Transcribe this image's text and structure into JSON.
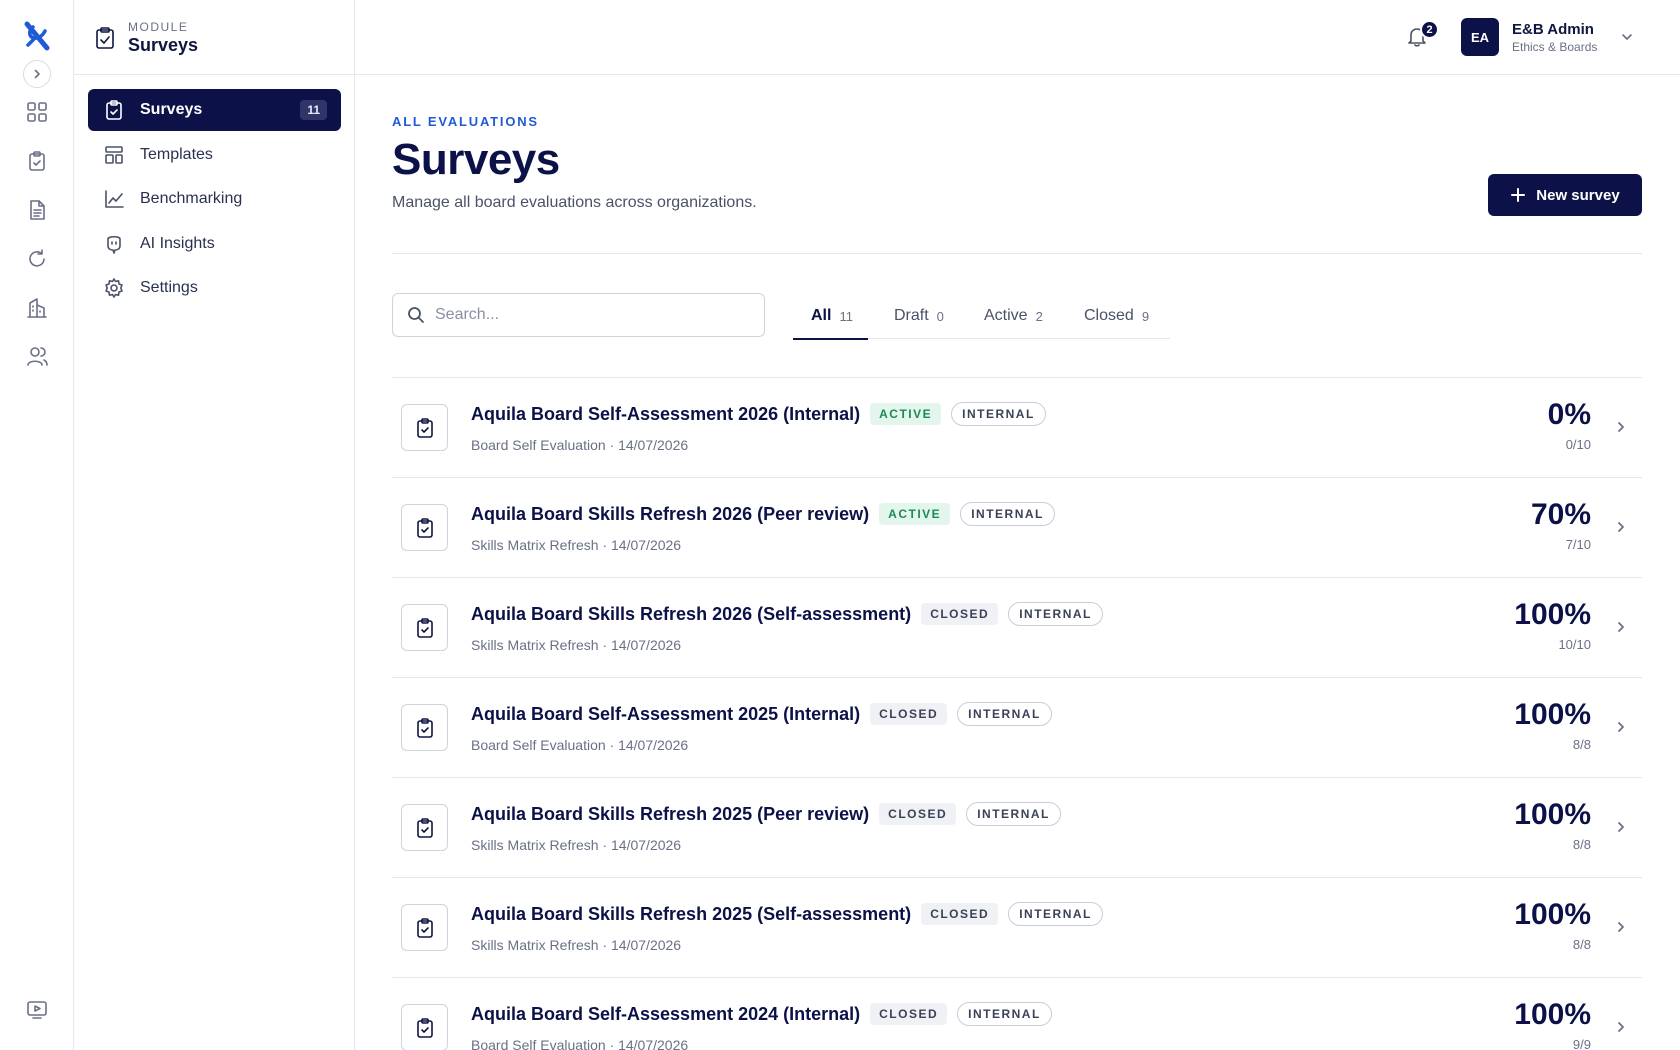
{
  "module": {
    "kicker": "MODULE",
    "name": "Surveys"
  },
  "sidebar": {
    "items": [
      {
        "label": "Surveys",
        "count": "11",
        "icon": "clipboard-check-icon",
        "active": true
      },
      {
        "label": "Templates",
        "icon": "layout-template-icon"
      },
      {
        "label": "Benchmarking",
        "icon": "chart-line-icon"
      },
      {
        "label": "AI Insights",
        "icon": "bot-icon"
      },
      {
        "label": "Settings",
        "icon": "gear-icon"
      }
    ]
  },
  "topbar": {
    "notifications": "2",
    "user": {
      "initials": "EA",
      "name": "E&B Admin",
      "org": "Ethics & Boards"
    }
  },
  "header": {
    "kicker": "ALL EVALUATIONS",
    "title": "Surveys",
    "subtitle": "Manage all board evaluations across organizations.",
    "new_button": "New survey"
  },
  "search": {
    "placeholder": "Search...",
    "value": ""
  },
  "tabs": [
    {
      "label": "All",
      "count": "11",
      "active": true
    },
    {
      "label": "Draft",
      "count": "0"
    },
    {
      "label": "Active",
      "count": "2"
    },
    {
      "label": "Closed",
      "count": "9"
    }
  ],
  "surveys": [
    {
      "title": "Aquila Board Self-Assessment 2026 (Internal)",
      "status": "ACTIVE",
      "type": "INTERNAL",
      "meta": "Board Self Evaluation · 14/07/2026",
      "percent": "0%",
      "fraction": "0/10"
    },
    {
      "title": "Aquila Board Skills Refresh 2026 (Peer review)",
      "status": "ACTIVE",
      "type": "INTERNAL",
      "meta": "Skills Matrix Refresh · 14/07/2026",
      "percent": "70%",
      "fraction": "7/10"
    },
    {
      "title": "Aquila Board Skills Refresh 2026 (Self-assessment)",
      "status": "CLOSED",
      "type": "INTERNAL",
      "meta": "Skills Matrix Refresh · 14/07/2026",
      "percent": "100%",
      "fraction": "10/10"
    },
    {
      "title": "Aquila Board Self-Assessment 2025 (Internal)",
      "status": "CLOSED",
      "type": "INTERNAL",
      "meta": "Board Self Evaluation · 14/07/2026",
      "percent": "100%",
      "fraction": "8/8"
    },
    {
      "title": "Aquila Board Skills Refresh 2025 (Peer review)",
      "status": "CLOSED",
      "type": "INTERNAL",
      "meta": "Skills Matrix Refresh · 14/07/2026",
      "percent": "100%",
      "fraction": "8/8"
    },
    {
      "title": "Aquila Board Skills Refresh 2025 (Self-assessment)",
      "status": "CLOSED",
      "type": "INTERNAL",
      "meta": "Skills Matrix Refresh · 14/07/2026",
      "percent": "100%",
      "fraction": "8/8"
    },
    {
      "title": "Aquila Board Self-Assessment 2024 (Internal)",
      "status": "CLOSED",
      "type": "INTERNAL",
      "meta": "Board Self Evaluation · 14/07/2026",
      "percent": "100%",
      "fraction": "9/9"
    }
  ],
  "colors": {
    "brand": "#0c1248",
    "accent": "#1f5bd6",
    "active_badge": "#1b8a55"
  },
  "rail_icons": [
    "dashboard-grid-icon",
    "clipboard-check-icon",
    "document-icon",
    "refresh-icon",
    "building-icon",
    "users-icon",
    "video-icon"
  ]
}
